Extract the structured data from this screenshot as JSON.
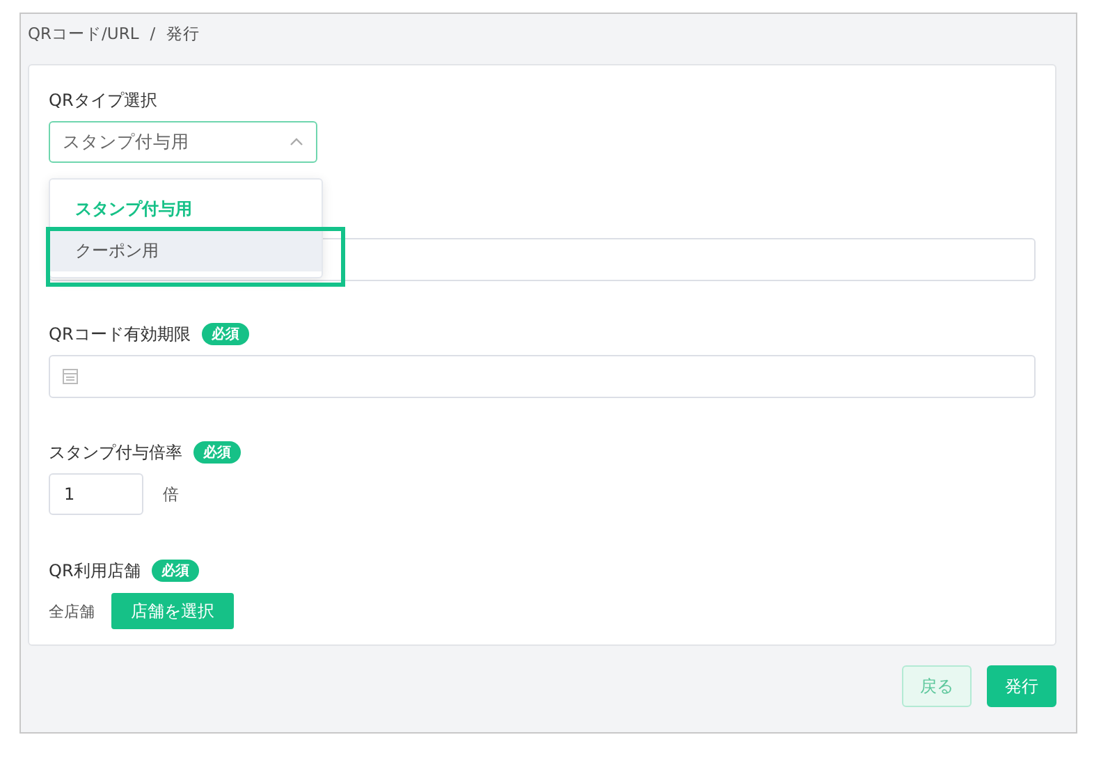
{
  "breadcrumb": [
    "QRコード/URL",
    "/",
    "発行"
  ],
  "qr_type": {
    "label": "QRタイプ選択",
    "value": "スタンプ付与用",
    "expanded": true,
    "options": [
      {
        "label": "スタンプ付与用",
        "selected": true,
        "hovered": false
      },
      {
        "label": "クーポン用",
        "selected": false,
        "hovered": true
      }
    ]
  },
  "expiry": {
    "label": "QRコード有効期限",
    "badge": "必須"
  },
  "rate": {
    "label": "スタンプ付与倍率",
    "badge": "必須",
    "value": "1",
    "unit": "倍"
  },
  "stores": {
    "label": "QR利用店舗",
    "badge": "必須",
    "value": "全店舗",
    "button": "店舗を選択"
  },
  "buttons": [
    {
      "label": "戻る",
      "kind": "secondary"
    },
    {
      "label": "発行",
      "kind": "primary"
    }
  ]
}
